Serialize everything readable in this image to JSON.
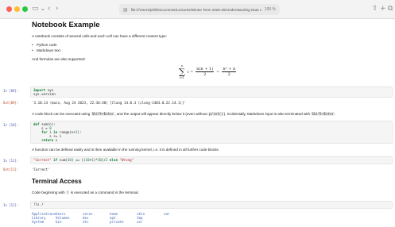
{
  "browser": {
    "url": "file:///Users/phil/Documents/Lectures/Winter Term 2025-26/Understanding Data vs Machine Learning/notebooks/test.html",
    "zoom": "100 %"
  },
  "notebook": {
    "title": "Notebook Example",
    "intro": "A notebook consists of several cells and each cell can have a different content type:",
    "bullets": [
      "Python code",
      "Markdown text"
    ],
    "formula_intro": "And formulas are also supported:",
    "cells": [
      {
        "prompt": "In [89]:",
        "lines": [
          "import sys",
          "sys.version"
        ]
      },
      {
        "out_prompt": "Out[89]:",
        "output": "'3.10.13 (main, Aug 24 2023, 22:36:48) [Clang 14.0.3 (clang-1403.0.22.14.1)]'"
      }
    ],
    "para1_a": "A code block can be executed using",
    "para1_code1": "Shift+Enter",
    "para1_b": ", and the output will appear directly below it (even without",
    "para1_code2": "print()",
    "para1_c": "). Incidentally, Markdown input is also terminated with",
    "para1_code3": "Shift+Enter",
    "para1_d": ".",
    "cell2": {
      "prompt": "In [10]:",
      "lines": [
        "def sum(n):",
        "    s = 0",
        "    for i in range(n+1):",
        "        s += i",
        "    return s"
      ]
    },
    "para2": "A function can be defined easily and is then available in the running kernel, i.e. it is defined in all further code blocks.",
    "cell3": {
      "prompt": "In [11]:",
      "line": "\"Correct\" if sum(10) == ((10+1)*10)/2 else \"Wrong\""
    },
    "cell3_out": {
      "prompt": "Out[11]:",
      "value": "'Correct'"
    },
    "section2_title": "Terminal Access",
    "para3_a": "Code beginning with",
    "para3_code": "!",
    "para3_b": "is executed as a command in the terminal.",
    "cell4": {
      "prompt": "In [12]:",
      "line": "!ls /"
    },
    "ls_output": [
      [
        "Applications",
        "Users",
        "cores",
        "home",
        "sbin",
        "var"
      ],
      [
        "Library",
        "Volumes",
        "dev",
        "opt",
        "tmp",
        ""
      ],
      [
        "System",
        "bin",
        "etc",
        "private",
        "usr",
        ""
      ]
    ]
  }
}
